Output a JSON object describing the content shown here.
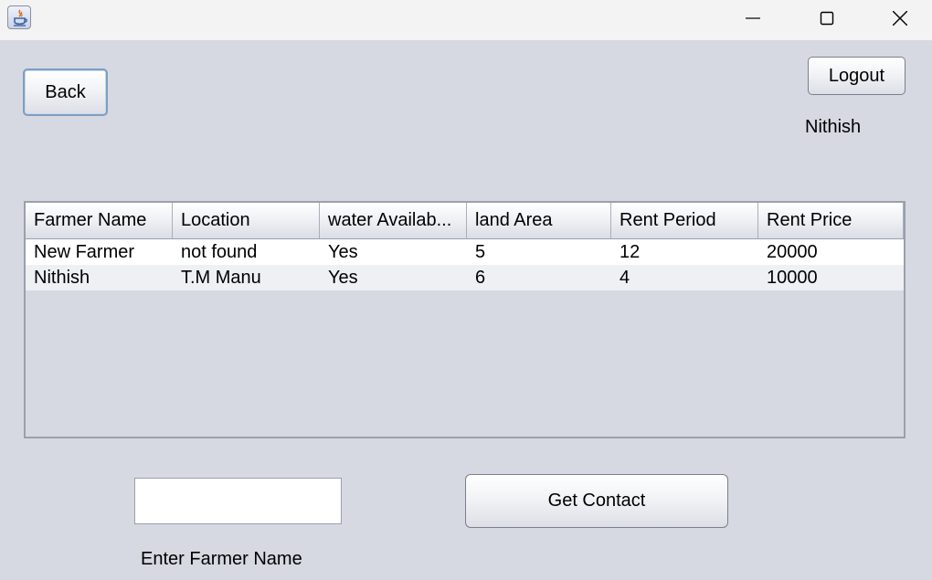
{
  "window": {
    "app_icon": "java-coffee-cup-icon"
  },
  "toolbar": {
    "back_label": "Back",
    "logout_label": "Logout",
    "username": "Nithish"
  },
  "table": {
    "columns": [
      "Farmer Name",
      "Location",
      "water Availab...",
      "land Area",
      "Rent Period",
      "Rent Price"
    ],
    "rows": [
      [
        "New Farmer",
        "not found",
        "Yes",
        "5",
        "12",
        "20000"
      ],
      [
        "Nithish",
        "T.M Manu",
        "Yes",
        "6",
        "4",
        "10000"
      ]
    ]
  },
  "form": {
    "farmer_name_value": "",
    "farmer_name_label": "Enter Farmer Name",
    "get_contact_label": "Get Contact"
  },
  "colors": {
    "background": "#d6d9e1",
    "titlebar": "#f3f3f3",
    "focus_border": "#7d9ec4"
  }
}
